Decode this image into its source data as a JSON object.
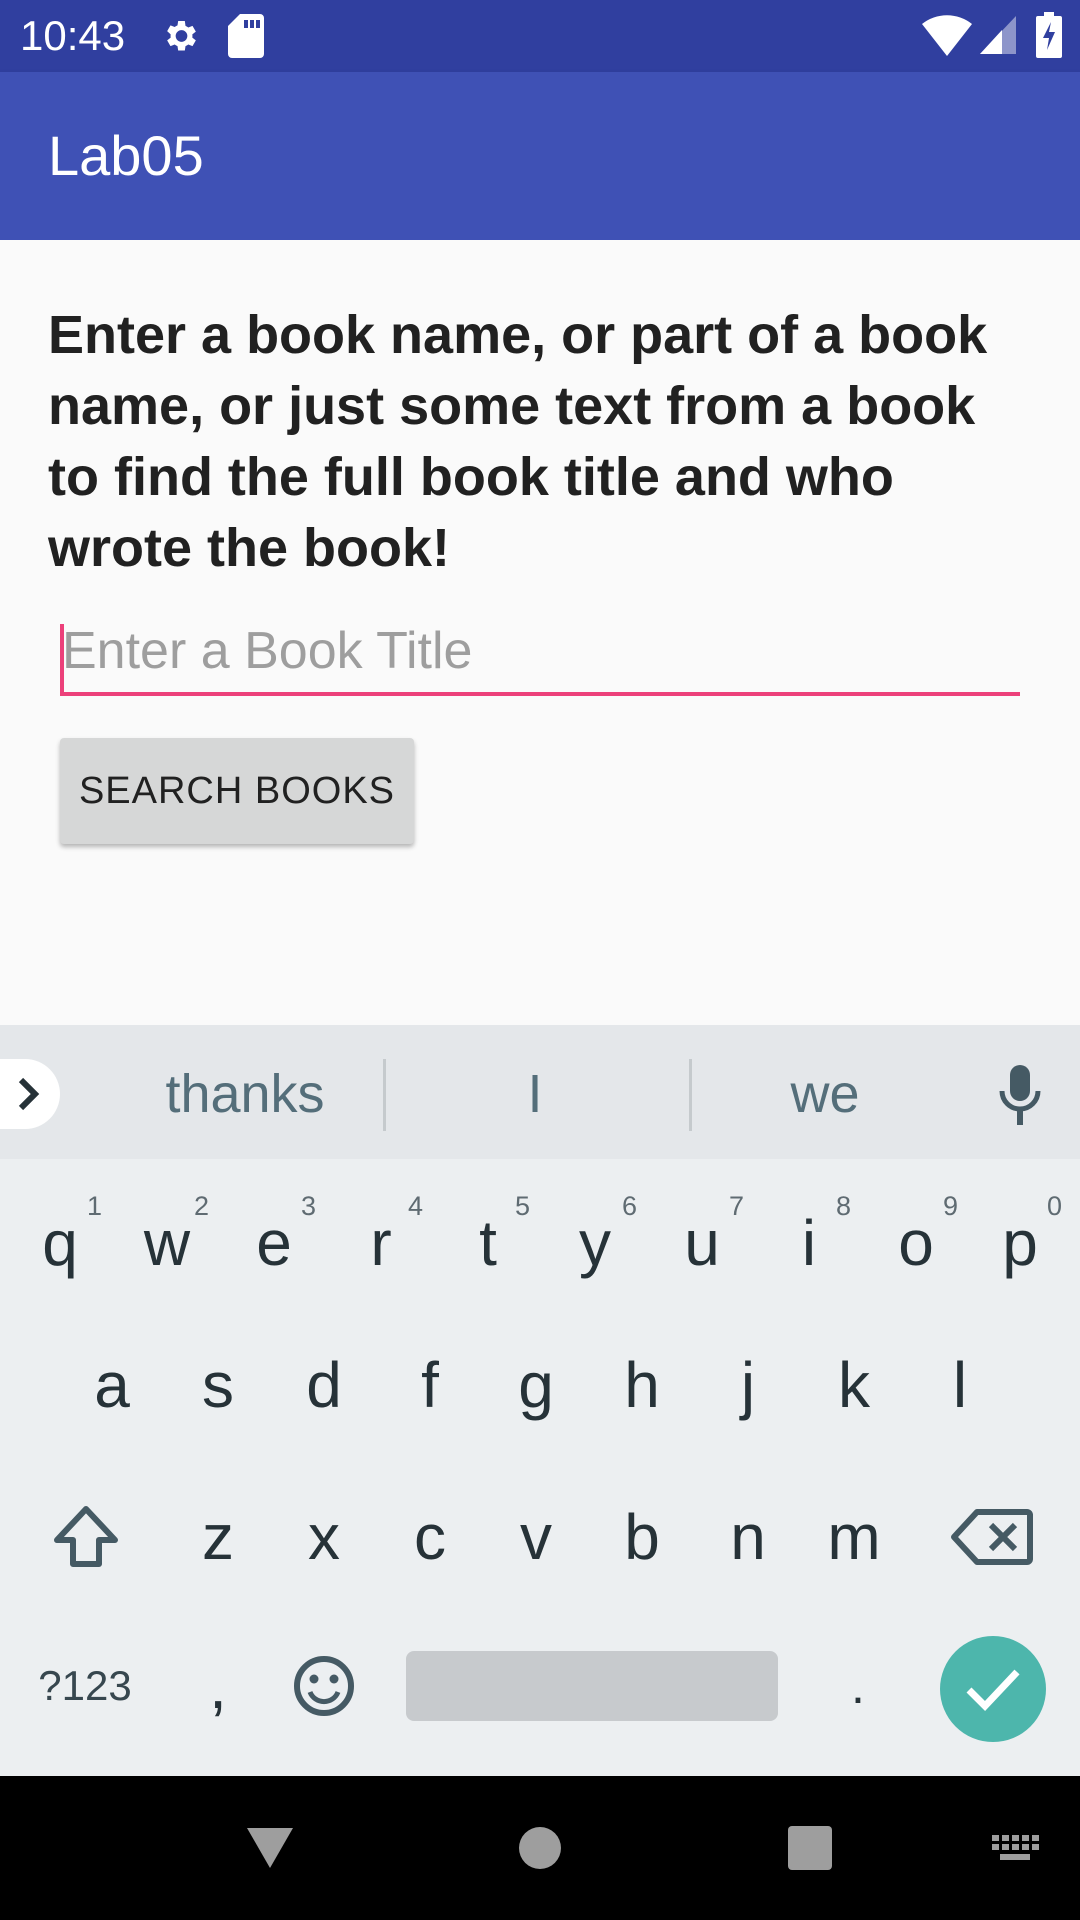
{
  "status_bar": {
    "time": "10:43",
    "left_icons": [
      "gear-icon",
      "sd-card-icon"
    ],
    "right_icons": [
      "wifi-icon",
      "signal-icon",
      "battery-charging-icon"
    ]
  },
  "app_bar": {
    "title": "Lab05"
  },
  "main": {
    "instructions": "Enter a book name, or part of a book name, or just some text from a book to find the full book title and who wrote the book!",
    "book_input": {
      "value": "",
      "placeholder": "Enter a Book Title"
    },
    "search_button_label": "SEARCH BOOKS"
  },
  "keyboard": {
    "suggestions": [
      "thanks",
      "I",
      "we"
    ],
    "row1": [
      {
        "key": "q",
        "hint": "1"
      },
      {
        "key": "w",
        "hint": "2"
      },
      {
        "key": "e",
        "hint": "3"
      },
      {
        "key": "r",
        "hint": "4"
      },
      {
        "key": "t",
        "hint": "5"
      },
      {
        "key": "y",
        "hint": "6"
      },
      {
        "key": "u",
        "hint": "7"
      },
      {
        "key": "i",
        "hint": "8"
      },
      {
        "key": "o",
        "hint": "9"
      },
      {
        "key": "p",
        "hint": "0"
      }
    ],
    "row2": [
      "a",
      "s",
      "d",
      "f",
      "g",
      "h",
      "j",
      "k",
      "l"
    ],
    "row3": [
      "z",
      "x",
      "c",
      "v",
      "b",
      "n",
      "m"
    ],
    "symbols_label": "?123",
    "comma_label": ",",
    "period_label": ".",
    "icons": [
      "shift-icon",
      "backspace-icon",
      "emoji-icon",
      "check-icon",
      "mic-icon",
      "chevron-right-icon"
    ]
  },
  "nav_bar": {
    "icons": [
      "back-icon",
      "home-icon",
      "recents-icon",
      "keyboard-switch-icon"
    ]
  },
  "colors": {
    "status_bar": "#303f9f",
    "app_bar": "#3f51b5",
    "accent": "#ec407a",
    "enter_key": "#4db6ac"
  }
}
